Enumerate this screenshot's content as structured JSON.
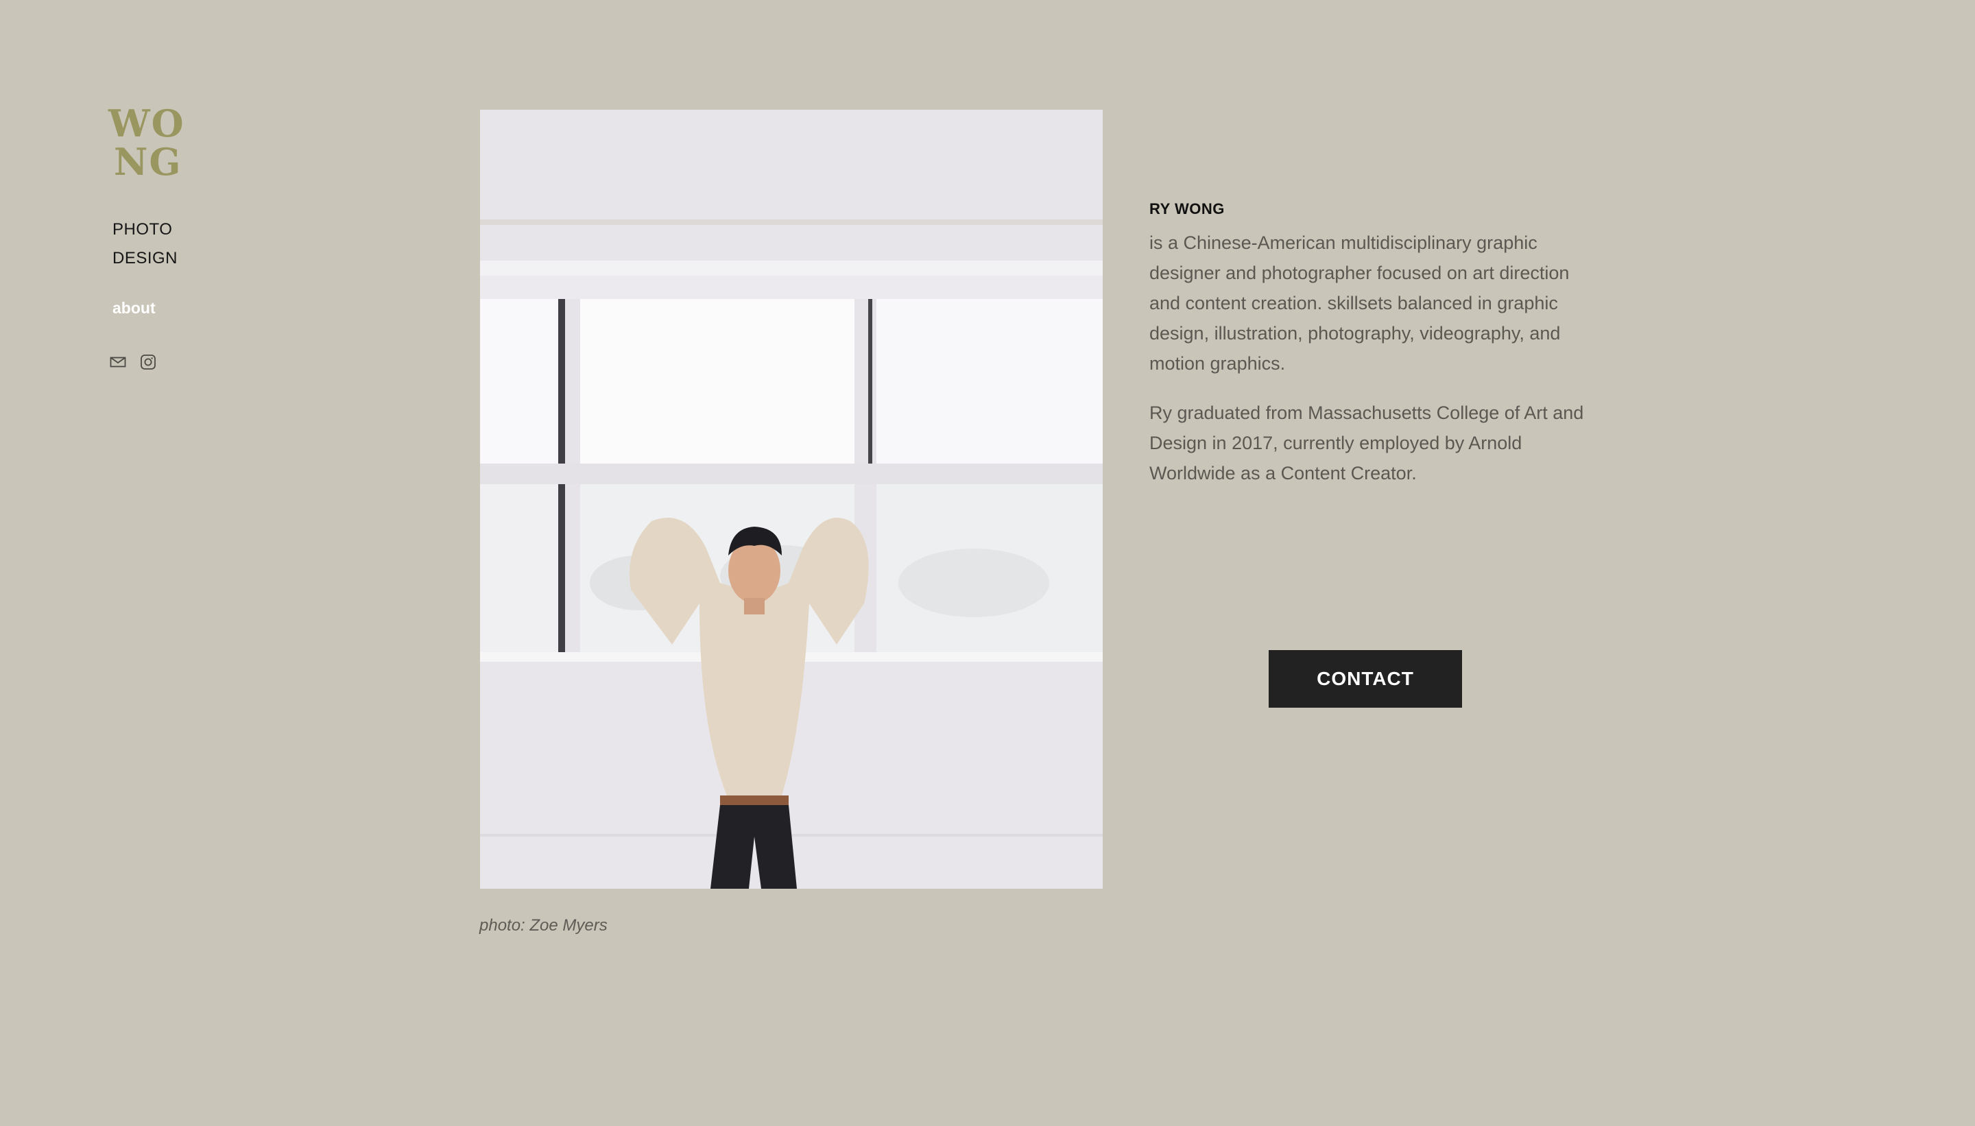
{
  "logo": {
    "line1": "WO",
    "line2": "NG",
    "color": "#9a9660"
  },
  "nav": {
    "items": [
      {
        "label": "PHOTO"
      },
      {
        "label": "DESIGN"
      }
    ],
    "about_label": "about"
  },
  "social": {
    "icons": [
      "mail-icon",
      "instagram-icon"
    ]
  },
  "photo": {
    "caption": "photo: Zoe Myers"
  },
  "bio": {
    "name": "RY WONG",
    "paragraph1": "is a Chinese-American multidisciplinary graphic designer and photographer focused on art direction and content creation. skillsets balanced in graphic design, illustration, photography, videography, and motion graphics.",
    "paragraph2": "Ry graduated from Massachusetts College of Art and Design in 2017, currently employed by Arnold Worldwide as a Content Creator."
  },
  "contact": {
    "label": "CONTACT"
  },
  "colors": {
    "background": "#c9c5b9",
    "button": "#222222",
    "text": "#5b5852"
  }
}
